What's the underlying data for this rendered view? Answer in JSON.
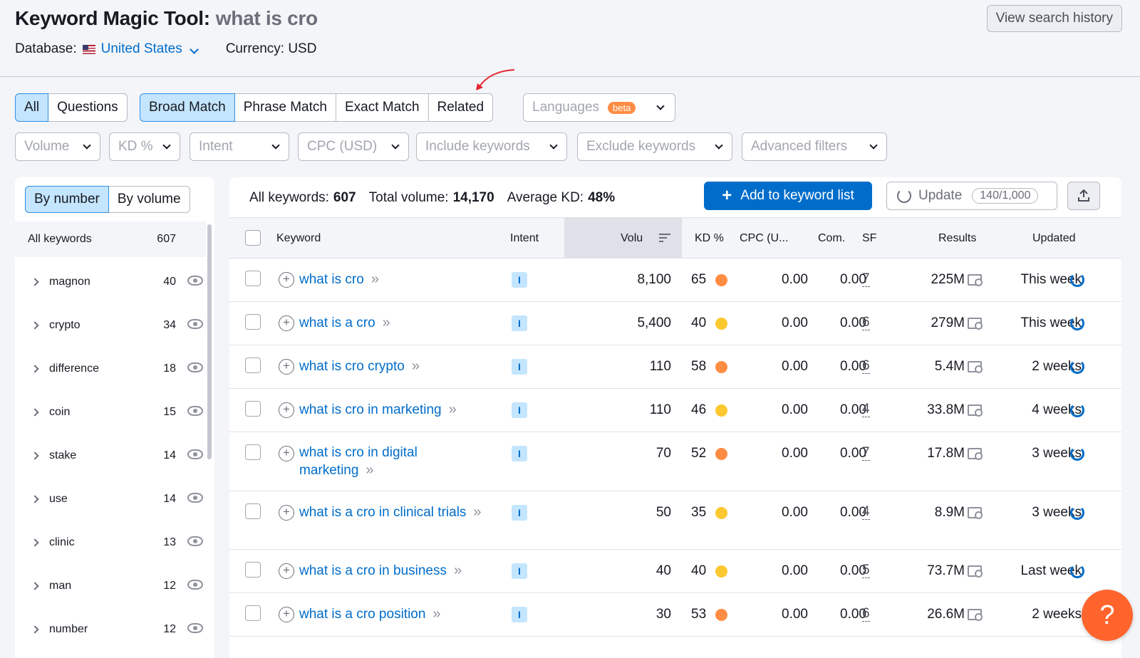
{
  "header": {
    "title": "Keyword Magic Tool:",
    "query": "what is cro",
    "database_label": "Database:",
    "database_value": "United States",
    "currency": "Currency: USD",
    "history_button": "View search history"
  },
  "tabs": {
    "scope": [
      "All",
      "Questions"
    ],
    "match": [
      "Broad Match",
      "Phrase Match",
      "Exact Match",
      "Related"
    ],
    "languages": "Languages",
    "beta": "beta"
  },
  "filters": [
    "Volume",
    "KD %",
    "Intent",
    "CPC (USD)",
    "Include keywords",
    "Exclude keywords",
    "Advanced filters"
  ],
  "left": {
    "sort": [
      "By number",
      "By volume"
    ],
    "all_label": "All keywords",
    "all_count": "607",
    "groups": [
      {
        "name": "magnon",
        "count": "40"
      },
      {
        "name": "crypto",
        "count": "34"
      },
      {
        "name": "difference",
        "count": "18"
      },
      {
        "name": "coin",
        "count": "15"
      },
      {
        "name": "stake",
        "count": "14"
      },
      {
        "name": "use",
        "count": "14"
      },
      {
        "name": "clinic",
        "count": "13"
      },
      {
        "name": "man",
        "count": "12"
      },
      {
        "name": "number",
        "count": "12"
      }
    ]
  },
  "summary": {
    "all_label": "All keywords:",
    "all_value": "607",
    "volume_label": "Total volume:",
    "volume_value": "14,170",
    "kd_label": "Average KD:",
    "kd_value": "48%",
    "add_button": "Add to keyword list",
    "update_button": "Update",
    "quota": "140/1,000"
  },
  "table": {
    "headers": [
      "Keyword",
      "Intent",
      "Volu",
      "KD %",
      "CPC (U...",
      "Com.",
      "SF",
      "Results",
      "Updated"
    ],
    "rows": [
      {
        "keyword": "what is cro",
        "intent": "I",
        "volume": "8,100",
        "kd": "65",
        "kd_color": "#ff8c43",
        "cpc": "0.00",
        "com": "0.00",
        "sf": "7",
        "results": "225M",
        "updated": "This week"
      },
      {
        "keyword": "what is a cro",
        "intent": "I",
        "volume": "5,400",
        "kd": "40",
        "kd_color": "#fcc82f",
        "cpc": "0.00",
        "com": "0.00",
        "sf": "6",
        "results": "279M",
        "updated": "This week"
      },
      {
        "keyword": "what is cro crypto",
        "intent": "I",
        "volume": "110",
        "kd": "58",
        "kd_color": "#ff8c43",
        "cpc": "0.00",
        "com": "0.00",
        "sf": "6",
        "results": "5.4M",
        "updated": "2 weeks"
      },
      {
        "keyword": "what is cro in marketing",
        "intent": "I",
        "volume": "110",
        "kd": "46",
        "kd_color": "#fcc82f",
        "cpc": "0.00",
        "com": "0.00",
        "sf": "4",
        "results": "33.8M",
        "updated": "4 weeks"
      },
      {
        "keyword": "what is cro in digital marketing",
        "intent": "I",
        "volume": "70",
        "kd": "52",
        "kd_color": "#ff8c43",
        "cpc": "0.00",
        "com": "0.00",
        "sf": "7",
        "results": "17.8M",
        "updated": "3 weeks"
      },
      {
        "keyword": "what is a cro in clinical trials",
        "intent": "I",
        "volume": "50",
        "kd": "35",
        "kd_color": "#fcc82f",
        "cpc": "0.00",
        "com": "0.00",
        "sf": "4",
        "results": "8.9M",
        "updated": "3 weeks"
      },
      {
        "keyword": "what is a cro in business",
        "intent": "I",
        "volume": "40",
        "kd": "40",
        "kd_color": "#fcc82f",
        "cpc": "0.00",
        "com": "0.00",
        "sf": "5",
        "results": "73.7M",
        "updated": "Last week"
      },
      {
        "keyword": "what is a cro position",
        "intent": "I",
        "volume": "30",
        "kd": "53",
        "kd_color": "#ff8c43",
        "cpc": "0.00",
        "com": "0.00",
        "sf": "6",
        "results": "26.6M",
        "updated": "2 weeks"
      }
    ]
  },
  "help": "?"
}
